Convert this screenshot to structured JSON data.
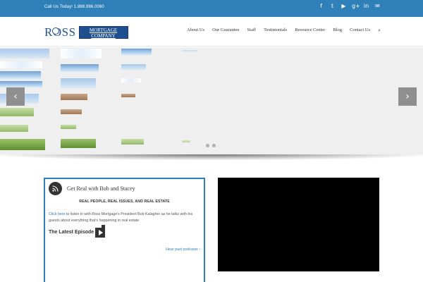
{
  "topbar": {
    "call_text": "Call Us Today! 1.888.986.0060",
    "social": [
      {
        "name": "facebook-icon",
        "glyph": "f"
      },
      {
        "name": "twitter-icon",
        "glyph": "t"
      },
      {
        "name": "youtube-icon",
        "glyph": "▶"
      },
      {
        "name": "googleplus-icon",
        "glyph": "g+"
      },
      {
        "name": "linkedin-icon",
        "glyph": "in"
      },
      {
        "name": "email-icon",
        "glyph": "✉"
      }
    ]
  },
  "logo": {
    "word": "ROSS",
    "box_line1": "MORTGAGE",
    "box_line2": "COMPANY"
  },
  "nav": {
    "items": [
      "About Us",
      "Our Guarantee",
      "Staff",
      "Testimonials",
      "Resource Center",
      "Blog",
      "Contact Us"
    ],
    "search_icon": "search-icon"
  },
  "slider": {
    "prev_icon": "chevron-left-icon",
    "next_icon": "chevron-right-icon",
    "prev_glyph": "‹",
    "next_glyph": "›",
    "slide_count": 2
  },
  "podcast": {
    "title": "Get Real with Bob and Stacey",
    "subtitle": "REAL PEOPLE, REAL ISSUES, AND REAL ESTATE",
    "desc_link": "Click here",
    "desc_rest": " to listen in with Ross Mortgage's President Bob Kalagher as he talks with his guests about everything that's happening in real estate",
    "latest_label": "The Latest Episode",
    "past_link": "Hear past podcasts ›"
  },
  "colors": {
    "brand_blue": "#2f7fb8",
    "logo_navy": "#1f4f8f"
  }
}
